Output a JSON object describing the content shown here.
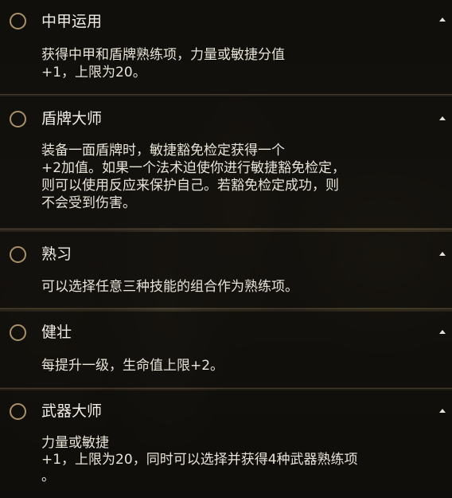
{
  "feats": [
    {
      "title": "中甲运用",
      "description": "获得中甲和盾牌熟练项，力量或敏捷分值\n+1，上限为20。",
      "icon": "radio-circle-icon",
      "collapse_icon": "caret-up-icon"
    },
    {
      "title": "盾牌大师",
      "description": "装备一面盾牌时，敏捷豁免检定获得一个\n+2加值。如果一个法术迫使你进行敏捷豁免检定，\n则可以使用反应来保护自己。若豁免检定成功，则\n不会受到伤害。",
      "icon": "radio-circle-icon",
      "collapse_icon": "caret-up-icon"
    },
    {
      "title": "熟习",
      "description": "可以选择任意三种技能的组合作为熟练项。",
      "icon": "radio-circle-icon",
      "collapse_icon": "caret-up-icon"
    },
    {
      "title": "健壮",
      "description": "每提升一级，生命值上限+2。",
      "icon": "radio-circle-icon",
      "collapse_icon": "caret-up-icon"
    },
    {
      "title": "武器大师",
      "description": "力量或敏捷\n+1，上限为20，同时可以选择并获得4种武器熟练项\n。",
      "icon": "radio-circle-icon",
      "collapse_icon": "caret-up-icon"
    }
  ],
  "colors": {
    "radio_border": "#a8916b",
    "panel_bg": "#0e0c0a",
    "text": "#e8e3d9"
  }
}
